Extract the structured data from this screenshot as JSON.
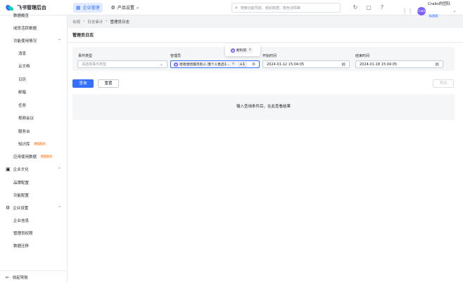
{
  "app": {
    "title": "飞书管理后台"
  },
  "topnav": {
    "tabs": [
      {
        "label": "企业管理",
        "icon": "building-icon",
        "active": true
      },
      {
        "label": "产品设置",
        "icon": "grid-settings-icon",
        "active": false
      }
    ],
    "search_placeholder": "搜索功能导航、组织数据、角色详情等",
    "icons": [
      "refresh-icon",
      "message-icon",
      "help-icon"
    ],
    "user": {
      "avatar_text": "Crabs",
      "name": "Crabs的团队",
      "badge": "标准版"
    }
  },
  "sidebar": {
    "items": [
      {
        "label": "数据概览",
        "level": "l1"
      },
      {
        "label": "成员活跃数据",
        "level": "l1"
      },
      {
        "label": "功能使用情况",
        "level": "l1",
        "expanded": true
      },
      {
        "label": "消息",
        "level": "l2"
      },
      {
        "label": "云文档",
        "level": "l2"
      },
      {
        "label": "日历",
        "level": "l2"
      },
      {
        "label": "邮箱",
        "level": "l2"
      },
      {
        "label": "任务",
        "level": "l2"
      },
      {
        "label": "视频会议",
        "level": "l2"
      },
      {
        "label": "服务台",
        "level": "l2"
      },
      {
        "label": "知识库",
        "level": "l2",
        "tag": "增强版本"
      },
      {
        "label": "应用使用数据",
        "level": "l1",
        "tag": "增强版本"
      }
    ],
    "groups": [
      {
        "label": "企业文化",
        "icon": "book-icon",
        "items": [
          "品牌配置",
          "功能配置"
        ]
      },
      {
        "label": "企业设置",
        "icon": "gear-icon",
        "items": [
          "企业信息",
          "管理员权限",
          "数据迁移"
        ]
      }
    ],
    "footer": "收起导航"
  },
  "breadcrumb": [
    "合规",
    "日志审计",
    "管理员日志"
  ],
  "page": {
    "title": "管理员日志",
    "filters": {
      "event_type": {
        "label": "事件类型",
        "placeholder": "请选择事件类型"
      },
      "admin": {
        "label": "管理员",
        "chip": "哈哈哈哈服务别人 饿个人售后1...",
        "more": "+1",
        "popover_chip": "断料的"
      },
      "start_time": {
        "label": "开始时间",
        "value": "2024-01-12 15:04:05"
      },
      "end_time": {
        "label": "结束时间",
        "value": "2024-01-18 15:04:05"
      }
    },
    "buttons": {
      "query": "查询",
      "reset": "重置",
      "export": "导出"
    },
    "empty_text": "输入查询条件后，在此查看结果"
  },
  "colors": {
    "primary": "#3370ff",
    "tag_orange": "#ed6d0c",
    "avatar": "#7b61ff"
  }
}
